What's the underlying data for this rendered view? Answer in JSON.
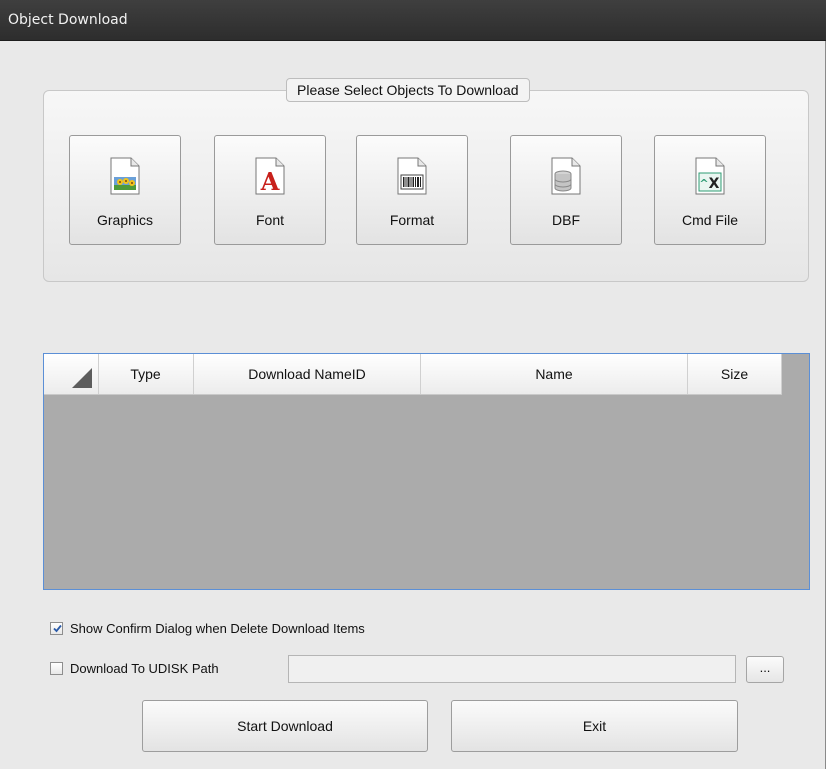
{
  "window": {
    "title": "Object Download"
  },
  "group": {
    "legend": "Please Select Objects To Download",
    "buttons": [
      {
        "label": "Graphics",
        "icon": "graphics-file-icon"
      },
      {
        "label": "Font",
        "icon": "font-file-icon"
      },
      {
        "label": "Format",
        "icon": "format-barcode-file-icon"
      },
      {
        "label": "DBF",
        "icon": "database-file-icon"
      },
      {
        "label": "Cmd File",
        "icon": "command-file-icon"
      }
    ]
  },
  "grid": {
    "columns": [
      "Type",
      "Download NameID",
      "Name",
      "Size"
    ],
    "rows": []
  },
  "options": {
    "confirm_delete": {
      "label": "Show Confirm Dialog when Delete Download Items",
      "checked": true
    },
    "udisk": {
      "label": "Download To UDISK Path",
      "checked": false,
      "path_value": "",
      "browse_label": "..."
    }
  },
  "actions": {
    "start_label": "Start Download",
    "exit_label": "Exit"
  },
  "colors": {
    "title_bar": "#333333",
    "grid_border": "#5b8fd6",
    "grid_body": "#ababab"
  }
}
